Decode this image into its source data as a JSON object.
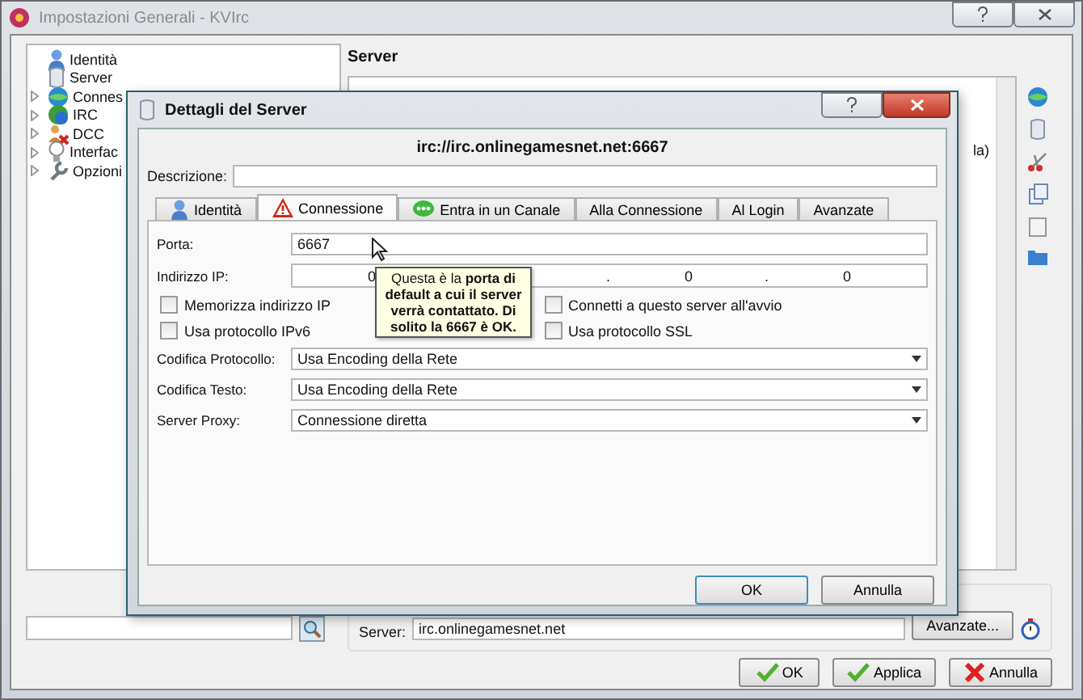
{
  "window": {
    "title": "Impostazioni Generali - KVIrc"
  },
  "tree": {
    "items": [
      {
        "label": "Identità",
        "expandable": false
      },
      {
        "label": "Server",
        "expandable": false
      },
      {
        "label": "Connes",
        "expandable": true
      },
      {
        "label": "IRC",
        "expandable": true
      },
      {
        "label": "DCC",
        "expandable": true
      },
      {
        "label": "Interfac",
        "expandable": true
      },
      {
        "label": "Opzioni",
        "expandable": true
      }
    ]
  },
  "server_panel": {
    "heading": "Server",
    "list_fragment": "la)",
    "server_label": "Server:",
    "server_value": "irc.onlinegamesnet.net",
    "advanced_button": "Avanzate..."
  },
  "buttons": [
    {
      "label": "OK",
      "kind": "ok"
    },
    {
      "label": "Applica",
      "kind": "ok"
    },
    {
      "label": "Annulla",
      "kind": "cancel"
    }
  ],
  "dialog": {
    "title": "Dettagli del Server",
    "url": "irc://irc.onlinegamesnet.net:6667",
    "description_label": "Descrizione:",
    "tabs": [
      {
        "label": "Identità",
        "selected": false
      },
      {
        "label": "Connessione",
        "selected": true
      },
      {
        "label": "Entra in un Canale",
        "selected": false
      },
      {
        "label": "Alla Connessione",
        "selected": false
      },
      {
        "label": "Al Login",
        "selected": false
      },
      {
        "label": "Avanzate",
        "selected": false
      }
    ],
    "port_label": "Porta:",
    "port_value": "6667",
    "ip_label": "Indirizzo IP:",
    "ip_octets": [
      "0",
      "0",
      "0"
    ],
    "ip_separator": ".",
    "checkboxes": [
      {
        "label": "Memorizza indirizzo IP",
        "checked": false
      },
      {
        "label": "Connetti a questo server all'avvio",
        "checked": false
      },
      {
        "label": "Usa protocollo IPv6",
        "checked": false
      },
      {
        "label": "Usa protocollo SSL",
        "checked": false
      }
    ],
    "combos": [
      {
        "label": "Codifica Protocollo:",
        "value": "Usa Encoding della Rete"
      },
      {
        "label": "Codifica Testo:",
        "value": "Usa Encoding della Rete"
      },
      {
        "label": "Server Proxy:",
        "value": "Connessione diretta"
      }
    ],
    "tooltip": "Questa è la **porta di default a cui il server verrà contattato. Di solito la 6667 è OK.**",
    "buttons": [
      "OK",
      "Annulla"
    ]
  }
}
